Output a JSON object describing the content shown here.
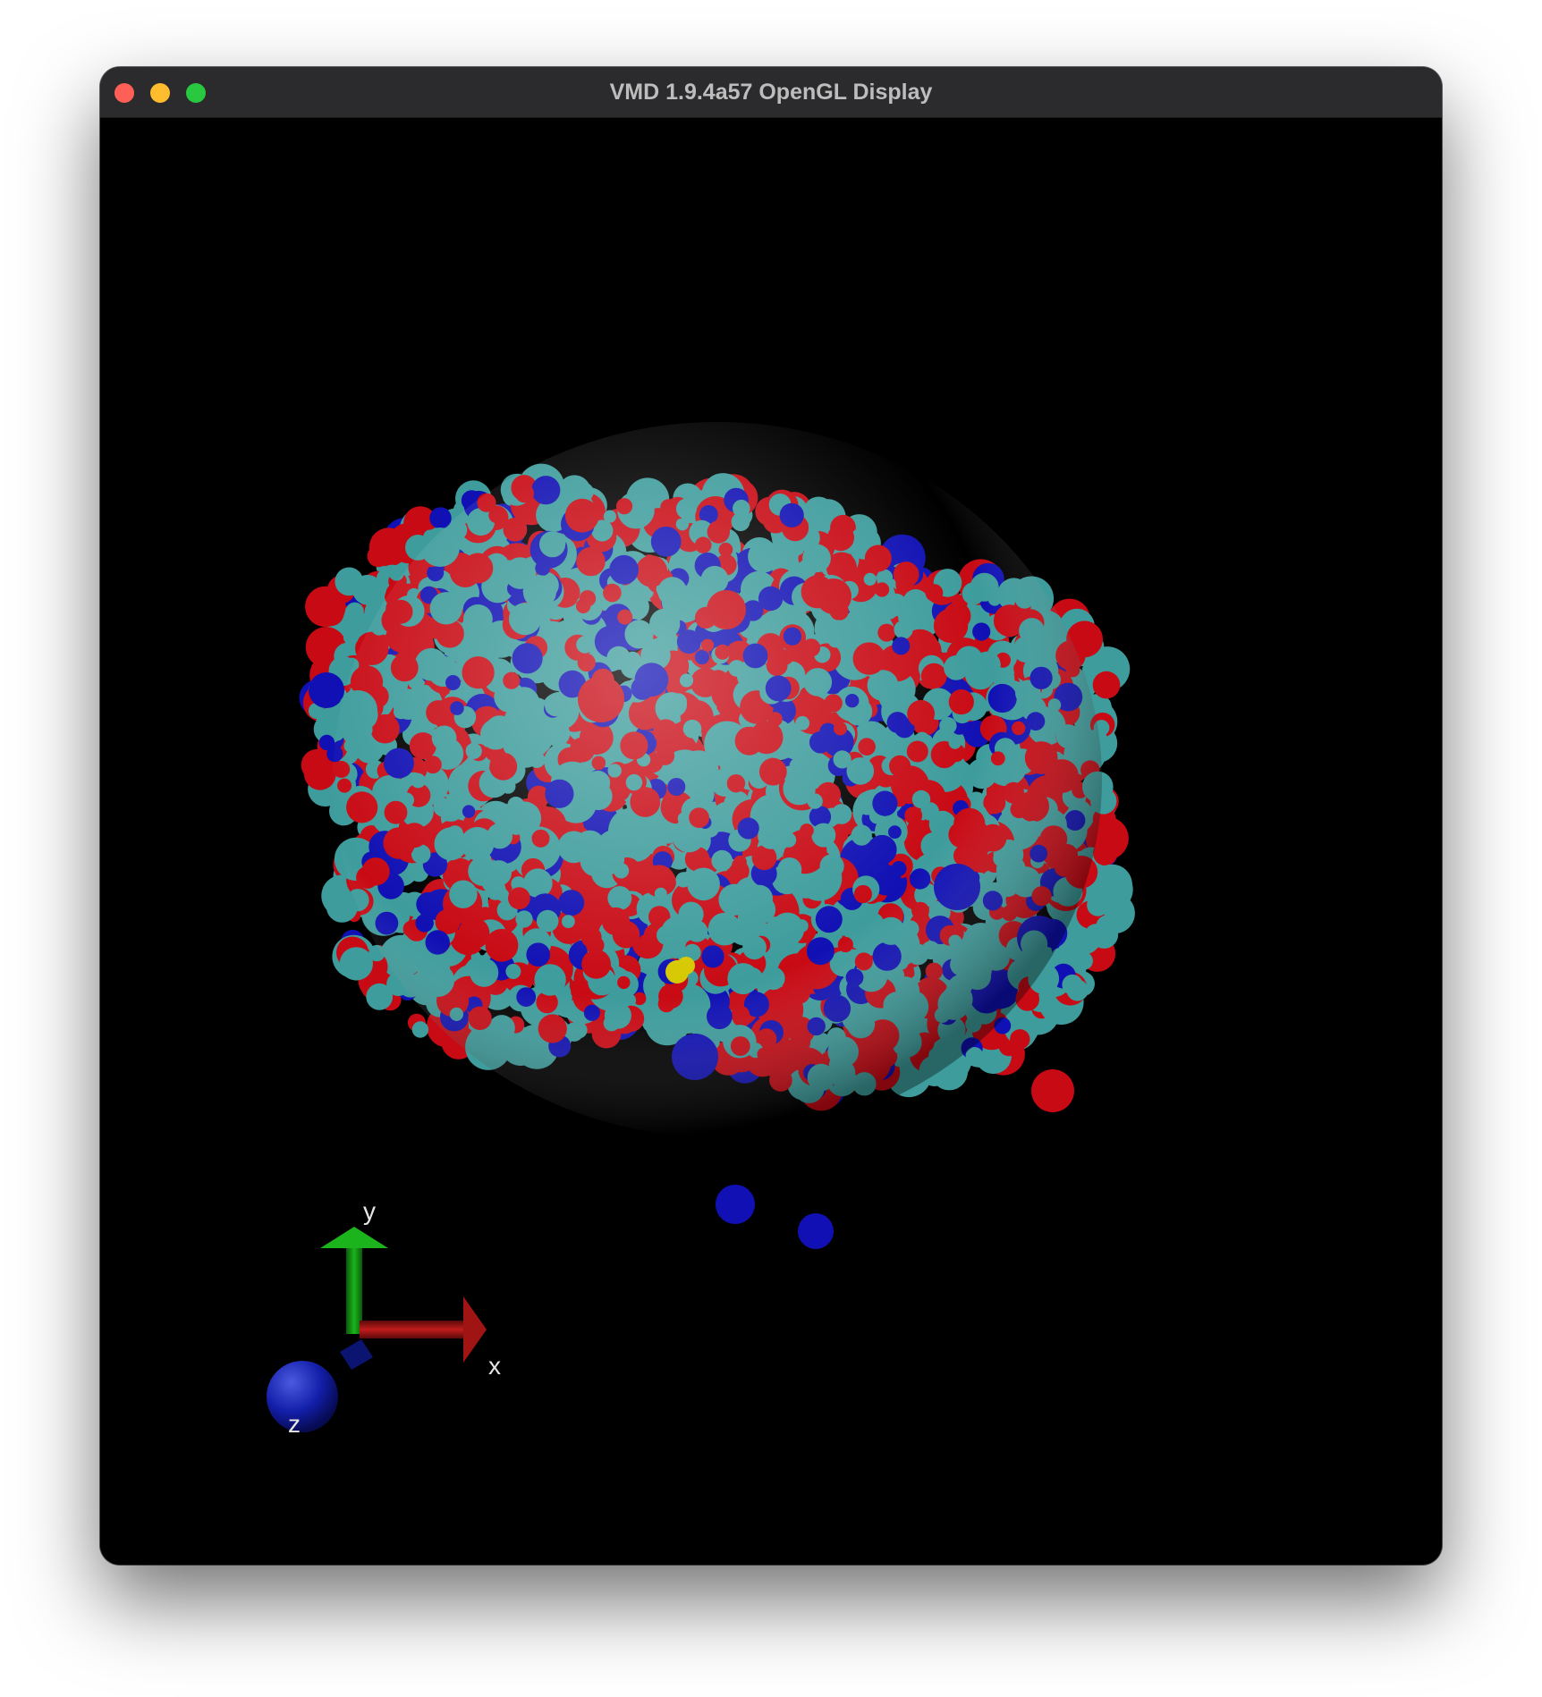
{
  "window": {
    "title": "VMD 1.9.4a57 OpenGL Display",
    "traffic_lights": {
      "close": "#fe5f57",
      "minimize": "#febc2e",
      "zoom": "#28c840"
    }
  },
  "scene": {
    "background_color": "#000000",
    "surface_colors": {
      "carbon": "#3e9c9c",
      "oxygen": "#c80a14",
      "nitrogen": "#1010b4",
      "sulfur": "#d6c800"
    }
  },
  "axes": {
    "x": {
      "label": "x",
      "color": "#a01414"
    },
    "y": {
      "label": "y",
      "color": "#129a12"
    },
    "z": {
      "label": "z",
      "color": "#121ea8"
    }
  }
}
